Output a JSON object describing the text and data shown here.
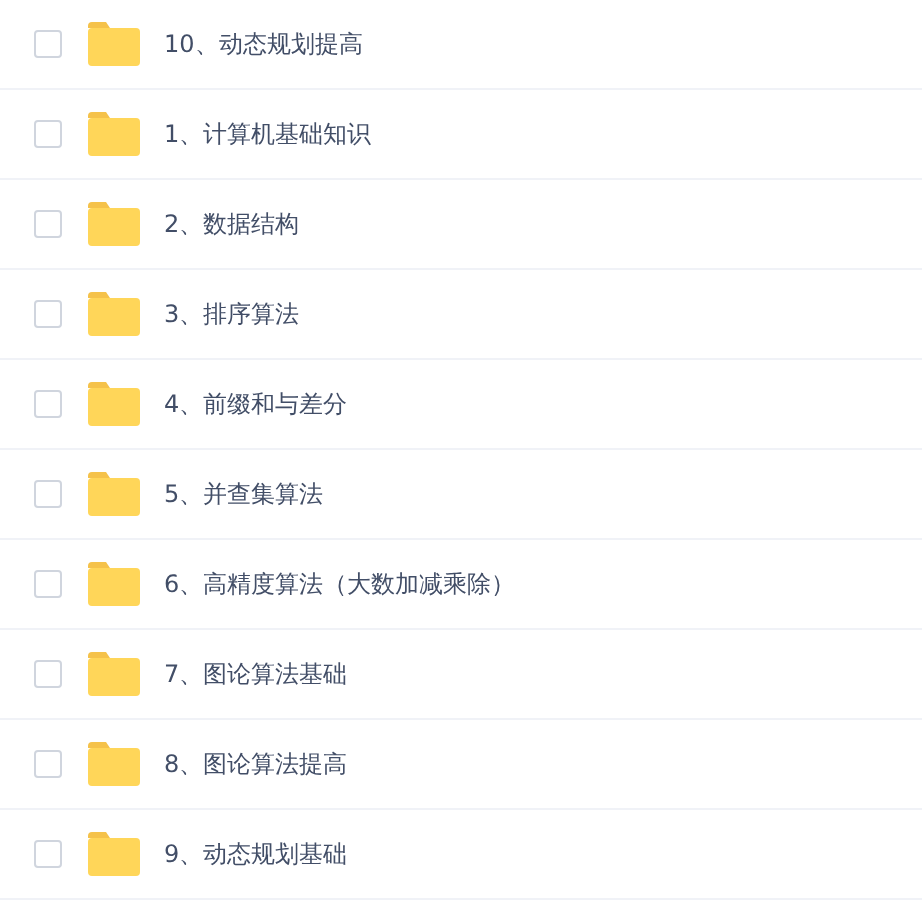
{
  "files": [
    {
      "name": "10、动态规划提高",
      "checked": false
    },
    {
      "name": "1、计算机基础知识",
      "checked": false
    },
    {
      "name": "2、数据结构",
      "checked": false
    },
    {
      "name": "3、排序算法",
      "checked": false
    },
    {
      "name": "4、前缀和与差分",
      "checked": false
    },
    {
      "name": "5、并查集算法",
      "checked": false
    },
    {
      "name": "6、高精度算法（大数加减乘除）",
      "checked": false
    },
    {
      "name": "7、图论算法基础",
      "checked": false
    },
    {
      "name": "8、图论算法提高",
      "checked": false
    },
    {
      "name": "9、动态规划基础",
      "checked": false
    }
  ]
}
